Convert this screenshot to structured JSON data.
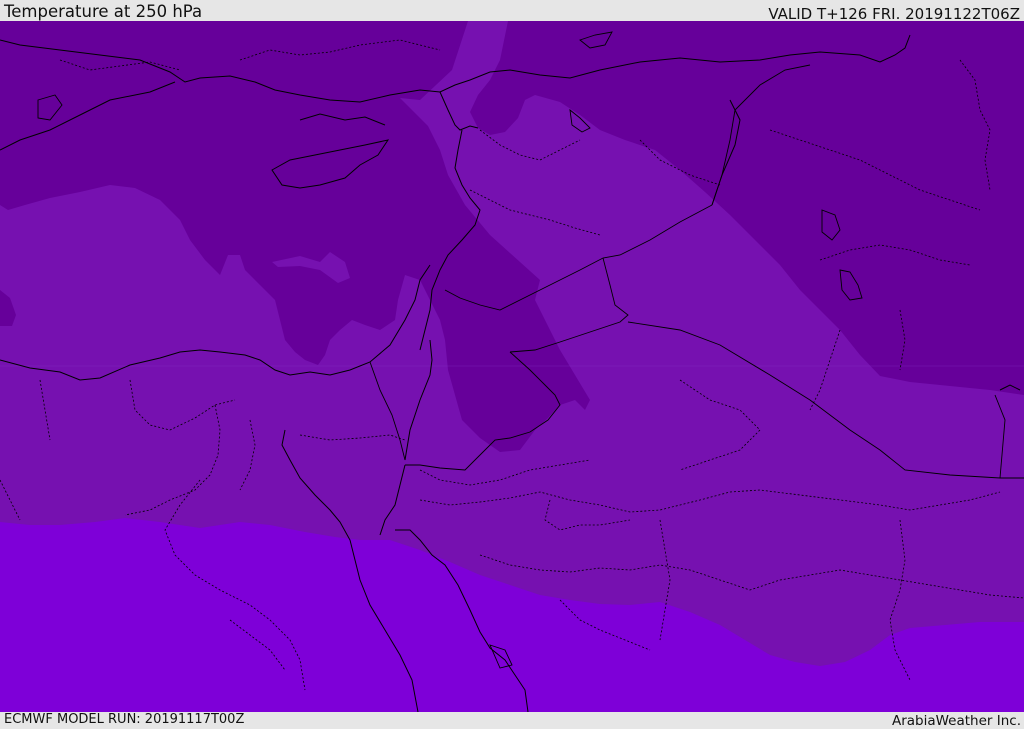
{
  "header": {
    "title": "Temperature at 250 hPa",
    "valid_time": "VALID T+126 FRI. 20191122T06Z"
  },
  "footer": {
    "model_run": "ECMWF MODEL RUN: 20191117T00Z",
    "credit": "ArabiaWeather Inc."
  },
  "map": {
    "field": "temperature",
    "level": "250 hPa",
    "colors": {
      "coldest_band": "#66009a",
      "middle_band": "#7611b0",
      "warm_band": "#7e00d8",
      "coastline": "#000000",
      "borders": "#000000"
    }
  }
}
